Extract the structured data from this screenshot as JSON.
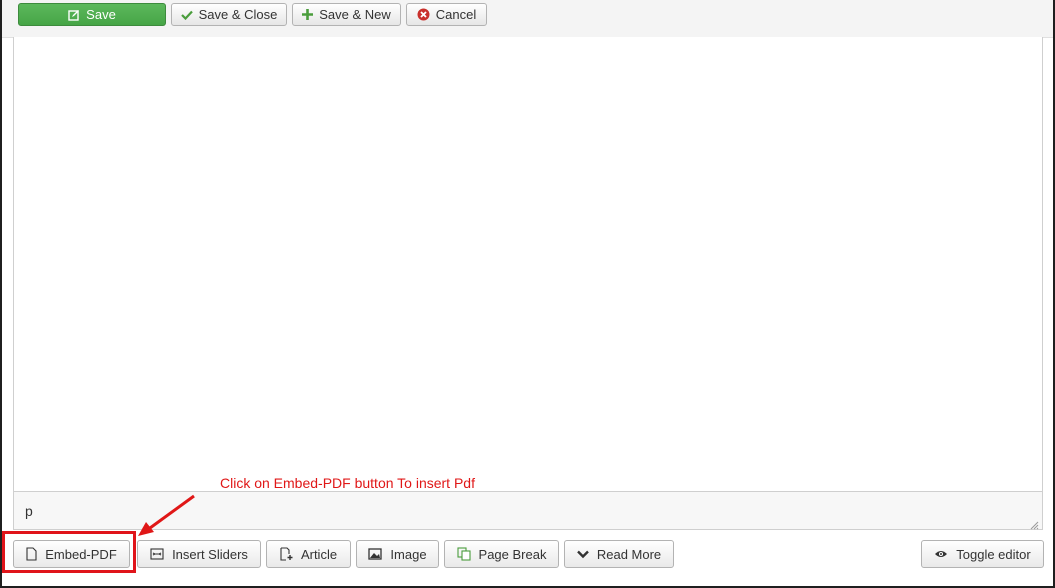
{
  "toolbar": {
    "save": "Save",
    "save_close": "Save & Close",
    "save_new": "Save & New",
    "cancel": "Cancel"
  },
  "editor": {
    "path": "p"
  },
  "buttons": {
    "embed_pdf": "Embed-PDF",
    "insert_sliders": "Insert Sliders",
    "article": "Article",
    "image": "Image",
    "page_break": "Page Break",
    "read_more": "Read More",
    "toggle_editor": "Toggle editor"
  },
  "annotation": {
    "text": "Click on Embed-PDF button To insert Pdf"
  },
  "colors": {
    "save_green": "#46a546",
    "annotation_red": "#e01717"
  }
}
